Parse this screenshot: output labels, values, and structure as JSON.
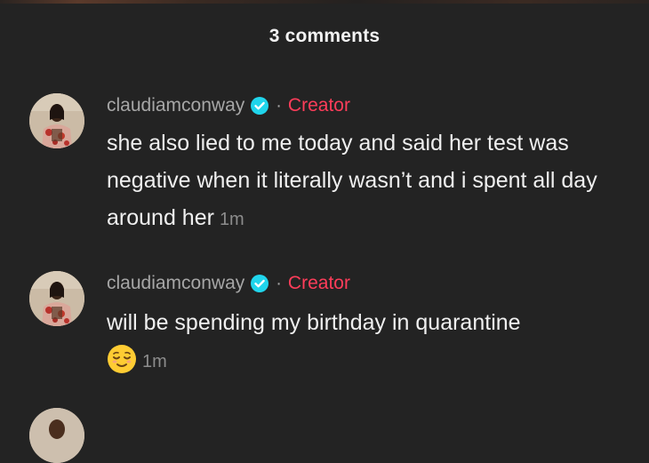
{
  "header": {
    "title": "3 comments"
  },
  "comments": [
    {
      "username": "claudiamconway",
      "separator": "·",
      "role": "Creator",
      "text": "she also lied to me today and said her test was negative when it literally wasn’t and i spent all day around her",
      "time": "1m"
    },
    {
      "username": "claudiamconway",
      "separator": "·",
      "role": "Creator",
      "text": "will be spending my birthday in quarantine",
      "emoji": "relieved-face-emoji",
      "time": "1m"
    }
  ],
  "colors": {
    "background": "#232323",
    "creator": "#ff3d5a",
    "verified": "#20d5ec",
    "username": "#a6a6a6",
    "timestamp": "#8c8c8c"
  },
  "icons": {
    "verified": "verified-badge-icon",
    "emoji": "relieved-face-emoji"
  }
}
